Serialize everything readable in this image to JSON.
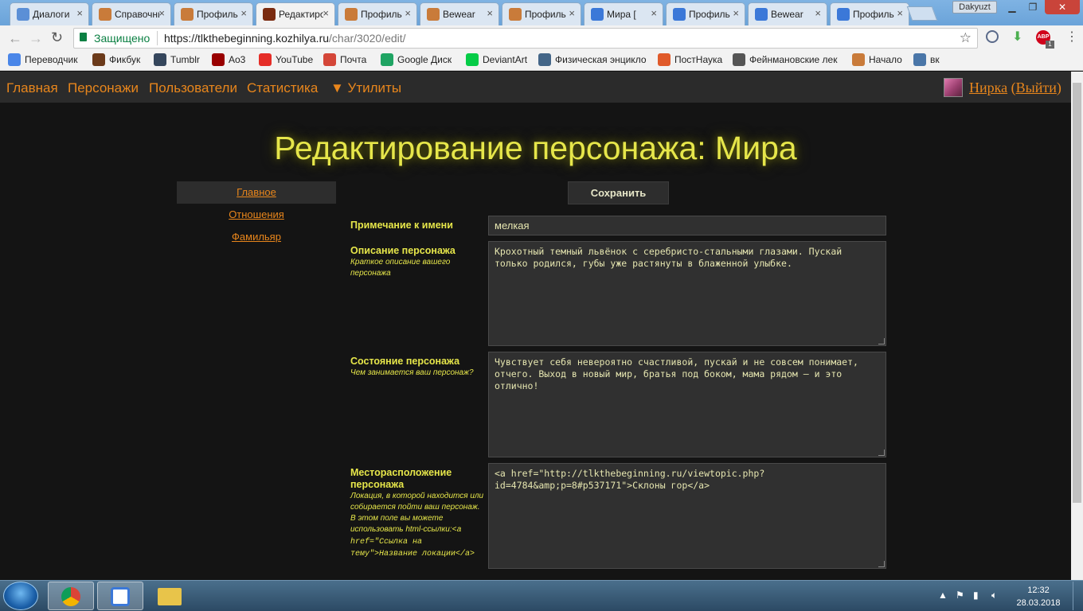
{
  "browser": {
    "tabs": [
      {
        "title": "Диалоги",
        "icon_color": "#5b8fd6"
      },
      {
        "title": "Справочник",
        "icon_color": "#c97b3a"
      },
      {
        "title": "Профиль",
        "icon_color": "#c97b3a"
      },
      {
        "title": "Редактирование",
        "icon_color": "#7a2b10",
        "active": true
      },
      {
        "title": "Профиль",
        "icon_color": "#c97b3a"
      },
      {
        "title": "Bewear",
        "icon_color": "#c97b3a"
      },
      {
        "title": "Профиль",
        "icon_color": "#c97b3a"
      },
      {
        "title": "Мира [",
        "icon_color": "#3b78d8"
      },
      {
        "title": "Профиль",
        "icon_color": "#3b78d8"
      },
      {
        "title": "Bewear",
        "icon_color": "#3b78d8"
      },
      {
        "title": "Профиль",
        "icon_color": "#3b78d8"
      }
    ],
    "window_user": "Dakyuzt",
    "secure_label": "Защищено",
    "url_host": "https://tlkthebeginning.kozhilya.ru",
    "url_path": "/char/3020/edit/",
    "adblock_count": "1",
    "bookmarks": [
      {
        "label": "Переводчик",
        "icon": "translate-icon",
        "color": "#4a86e8"
      },
      {
        "label": "Фикбук",
        "icon": "quill-icon",
        "color": "#6b3a1a"
      },
      {
        "label": "Tumblr",
        "icon": "tumblr-icon",
        "color": "#35465c"
      },
      {
        "label": "Ao3",
        "icon": "ao3-icon",
        "color": "#990000"
      },
      {
        "label": "YouTube",
        "icon": "youtube-icon",
        "color": "#e52d27"
      },
      {
        "label": "Почта",
        "icon": "gmail-icon",
        "color": "#d44638"
      },
      {
        "label": "Google Диск",
        "icon": "drive-icon",
        "color": "#1fa463"
      },
      {
        "label": "DeviantArt",
        "icon": "deviantart-icon",
        "color": "#05cc47"
      },
      {
        "label": "Физическая энцикло",
        "icon": "physics-icon",
        "color": "#446688"
      },
      {
        "label": "ПостНаука",
        "icon": "pi-icon",
        "color": "#e05a2a"
      },
      {
        "label": "Фейнмановские лек",
        "icon": "feynman-icon",
        "color": "#555555"
      },
      {
        "label": "Начало",
        "icon": "lion-icon",
        "color": "#c97b3a"
      },
      {
        "label": "вк",
        "icon": "vk-icon",
        "color": "#4a76a8"
      }
    ]
  },
  "site": {
    "nav": {
      "home": "Главная",
      "characters": "Персонажи",
      "users": "Пользователи",
      "stats": "Статистика",
      "utils": "▼ Утилиты"
    },
    "user": {
      "name": "Нирка",
      "logout_open": "(",
      "logout": "Выйти",
      "logout_close": ")"
    },
    "page_title": "Редактирование персонажа: Мира",
    "side_menu": {
      "main": "Главное",
      "relations": "Отношения",
      "familiar": "Фамильяр"
    },
    "save_label": "Сохранить",
    "form": {
      "name_note": {
        "label": "Примечание к имени",
        "value": "мелкая"
      },
      "description": {
        "label": "Описание персонажа",
        "hint": "Краткое описание вашего персонажа",
        "value": "Крохотный темный львёнок с серебристо-стальными глазами. Пускай\nтолько родился, губы уже растянуты в блаженной улыбке."
      },
      "state": {
        "label": "Состояние персонажа",
        "hint": "Чем занимается ваш персонаж?",
        "value": "Чувствует себя невероятно счастливой, пускай и не совсем понимает,\nотчего. Выход в новый мир, братья под боком, мама рядом — и это\nотлично!"
      },
      "location": {
        "label": "Месторасположение персонажа",
        "hint": "Локация, в которой находится или собирается пойти ваш персонаж. В этом поле вы можете использовать html-ссылки:",
        "hint_code": "<a href=\"Ссылка на тему\">Название локации</a>",
        "value": "<a href=\"http://tlkthebeginning.ru/viewtopic.php?\nid=4784&amp;p=8#p537171\">Склоны гор</a>"
      }
    }
  },
  "taskbar": {
    "time": "12:32",
    "date": "28.03.2018"
  }
}
